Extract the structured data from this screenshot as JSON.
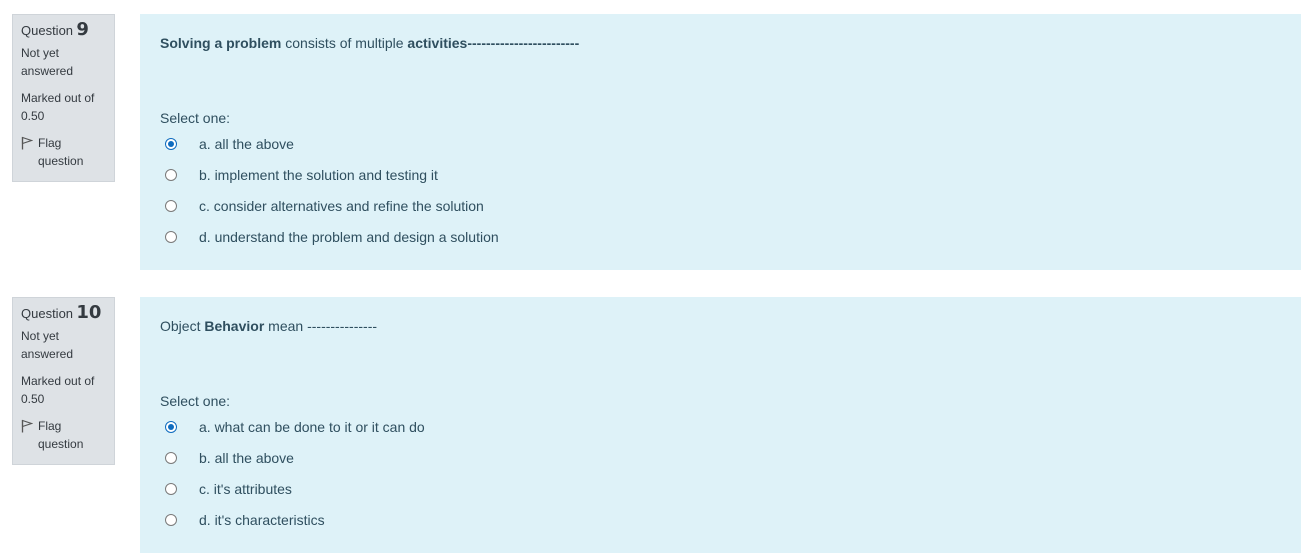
{
  "questions": [
    {
      "qno_label": "Question",
      "qno": "9",
      "state": "Not yet answered",
      "grade": "Marked out of 0.50",
      "flag_label": "Flag question",
      "text_parts": [
        {
          "text": "Solving a problem",
          "bold": true
        },
        {
          "text": " consists of multiple ",
          "bold": false
        },
        {
          "text": "activities",
          "bold": true
        },
        {
          "text": "------------------------",
          "bold": false
        }
      ],
      "prompt": "Select one:",
      "answers": [
        {
          "label": "a. all the above",
          "checked": true
        },
        {
          "label": "b. implement the solution and testing it",
          "checked": false
        },
        {
          "label": "c. consider alternatives and refine the solution",
          "checked": false
        },
        {
          "label": "d. understand the problem and design a solution",
          "checked": false
        }
      ]
    },
    {
      "qno_label": "Question",
      "qno": "10",
      "state": "Not yet answered",
      "grade": "Marked out of 0.50",
      "flag_label": "Flag question",
      "text_parts": [
        {
          "text": "Object ",
          "bold": false
        },
        {
          "text": "Behavior",
          "bold": true
        },
        {
          "text": " mean ---------------",
          "bold": false
        }
      ],
      "prompt": "Select one:",
      "answers": [
        {
          "label": "a. what can be done to it or it can do",
          "checked": true
        },
        {
          "label": "b. all the above",
          "checked": false
        },
        {
          "label": "c. it's attributes",
          "checked": false
        },
        {
          "label": "d. it's characteristics",
          "checked": false
        }
      ]
    }
  ],
  "colors": {
    "info_bg": "#dee2e6",
    "content_bg": "#def2f8",
    "radio_checked": "#0f6cbf",
    "text": "#2f4f5f"
  }
}
